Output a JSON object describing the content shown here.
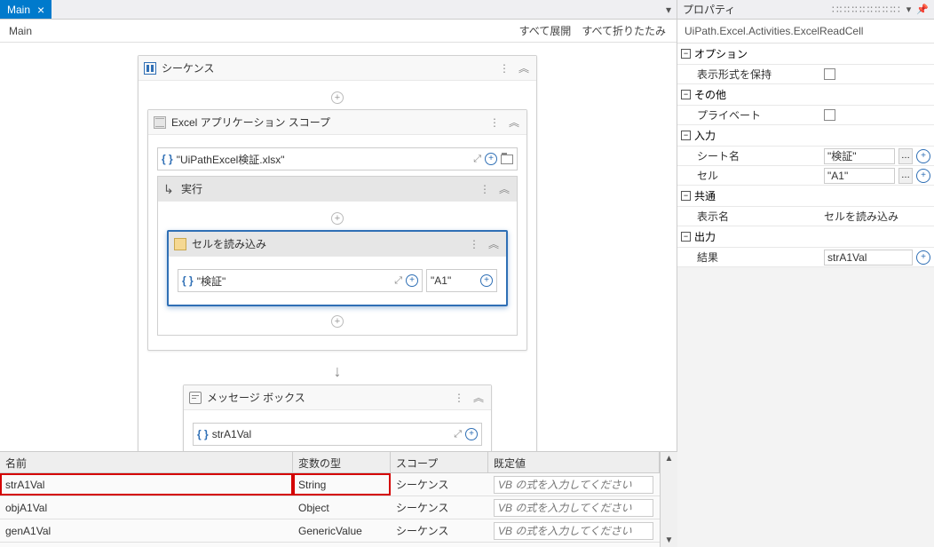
{
  "tab": {
    "title": "Main",
    "close": "×"
  },
  "breadcrumb": {
    "main": "Main",
    "expandAll": "すべて展開",
    "collapseAll": "すべて折りたたみ"
  },
  "seq": {
    "title": "シーケンス"
  },
  "excelScope": {
    "title": "Excel アプリケーション スコープ",
    "expr": "\"UiPathExcel検証.xlsx\""
  },
  "exec": {
    "title": "実行"
  },
  "readCell": {
    "title": "セルを読み込み",
    "sheet": "\"検証\"",
    "cell": "\"A1\""
  },
  "msgBox": {
    "title": "メッセージ ボックス",
    "expr": "strA1Val"
  },
  "props": {
    "panelTitle": "プロパティ",
    "typeName": "UiPath.Excel.Activities.ExcelReadCell",
    "cat_option": "オプション",
    "preserveFormat": "表示形式を保持",
    "cat_misc": "その他",
    "private": "プライベート",
    "cat_input": "入力",
    "sheetName": "シート名",
    "sheetVal": "\"検証\"",
    "cellName": "セル",
    "cellVal": "\"A1\"",
    "cat_common": "共通",
    "displayName": "表示名",
    "displayVal": "セルを読み込み",
    "cat_output": "出力",
    "result": "結果",
    "resultVal": "strA1Val"
  },
  "vars": {
    "hdr_name": "名前",
    "hdr_type": "変数の型",
    "hdr_scope": "スコープ",
    "hdr_default": "既定値",
    "placeholder": "VB の式を入力してください",
    "rows": [
      {
        "name": "strA1Val",
        "type": "String",
        "scope": "シーケンス",
        "hl": true
      },
      {
        "name": "objA1Val",
        "type": "Object",
        "scope": "シーケンス",
        "hl": false
      },
      {
        "name": "genA1Val",
        "type": "GenericValue",
        "scope": "シーケンス",
        "hl": false
      }
    ]
  }
}
